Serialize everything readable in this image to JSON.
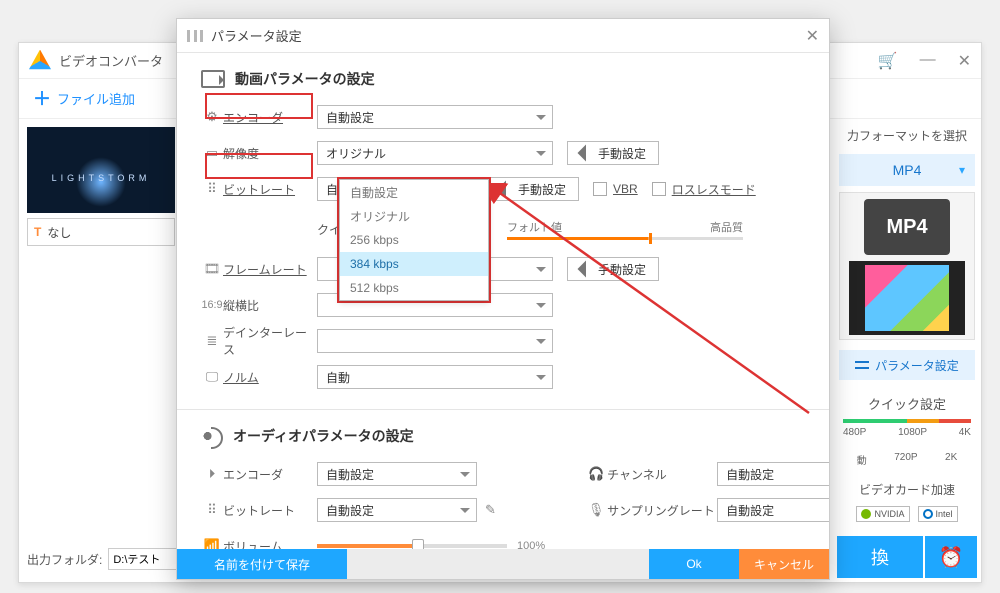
{
  "app": {
    "title": "ビデオコンバータ",
    "add_file": "ファイル追加",
    "track_none": "なし",
    "out_folder_label": "出力フォルダ:",
    "out_folder_value": "D:\\テスト",
    "convert": "換"
  },
  "right": {
    "choose_fmt": "力フォーマットを選択",
    "format": "MP4",
    "mp4_badge": "MP4",
    "param_btn": "パラメータ設定",
    "quick_title": "クイック設定",
    "res_top": [
      "480P",
      "1080P",
      "4K"
    ],
    "res_bottom": [
      "動",
      "720P",
      "2K"
    ],
    "gpu_title": "ビデオカード加速",
    "nvidia": "NVIDIA",
    "intel": "Intel"
  },
  "dialog": {
    "title": "パラメータ設定",
    "video_section": "動画パラメータの設定",
    "audio_section": "オーディオパラメータの設定",
    "labels": {
      "encoder": "エンコーダ",
      "resolution": "解像度",
      "bitrate": "ビットレート",
      "framerate": "フレームレート",
      "aspect": "縦横比",
      "deinterlace": "デインターレース",
      "norm": "ノルム",
      "a_encoder": "エンコーダ",
      "a_bitrate": "ビットレート",
      "a_volume": "ボリューム",
      "channel": "チャンネル",
      "sample": "サンプリングレート"
    },
    "values": {
      "encoder": "自動設定",
      "resolution": "オリジナル",
      "bitrate": "自動設定",
      "norm": "自動",
      "a_encoder": "自動設定",
      "a_bitrate": "自動設定",
      "channel": "自動設定",
      "sample": "自動設定"
    },
    "manual_btn": "手動設定",
    "vbr": "VBR",
    "lossless": "ロスレスモード",
    "quick_label_prefix": "クイック設",
    "default_label": "フォルト値",
    "hq_label": "高品質",
    "dropdown": [
      "自動設定",
      "オリジナル",
      "256 kbps",
      "384 kbps",
      "512 kbps"
    ],
    "dropdown_selected_index": 3,
    "volume_pct": "100%",
    "footer": {
      "save_as": "名前を付けて保存",
      "ok": "Ok",
      "cancel": "キャンセル"
    }
  }
}
